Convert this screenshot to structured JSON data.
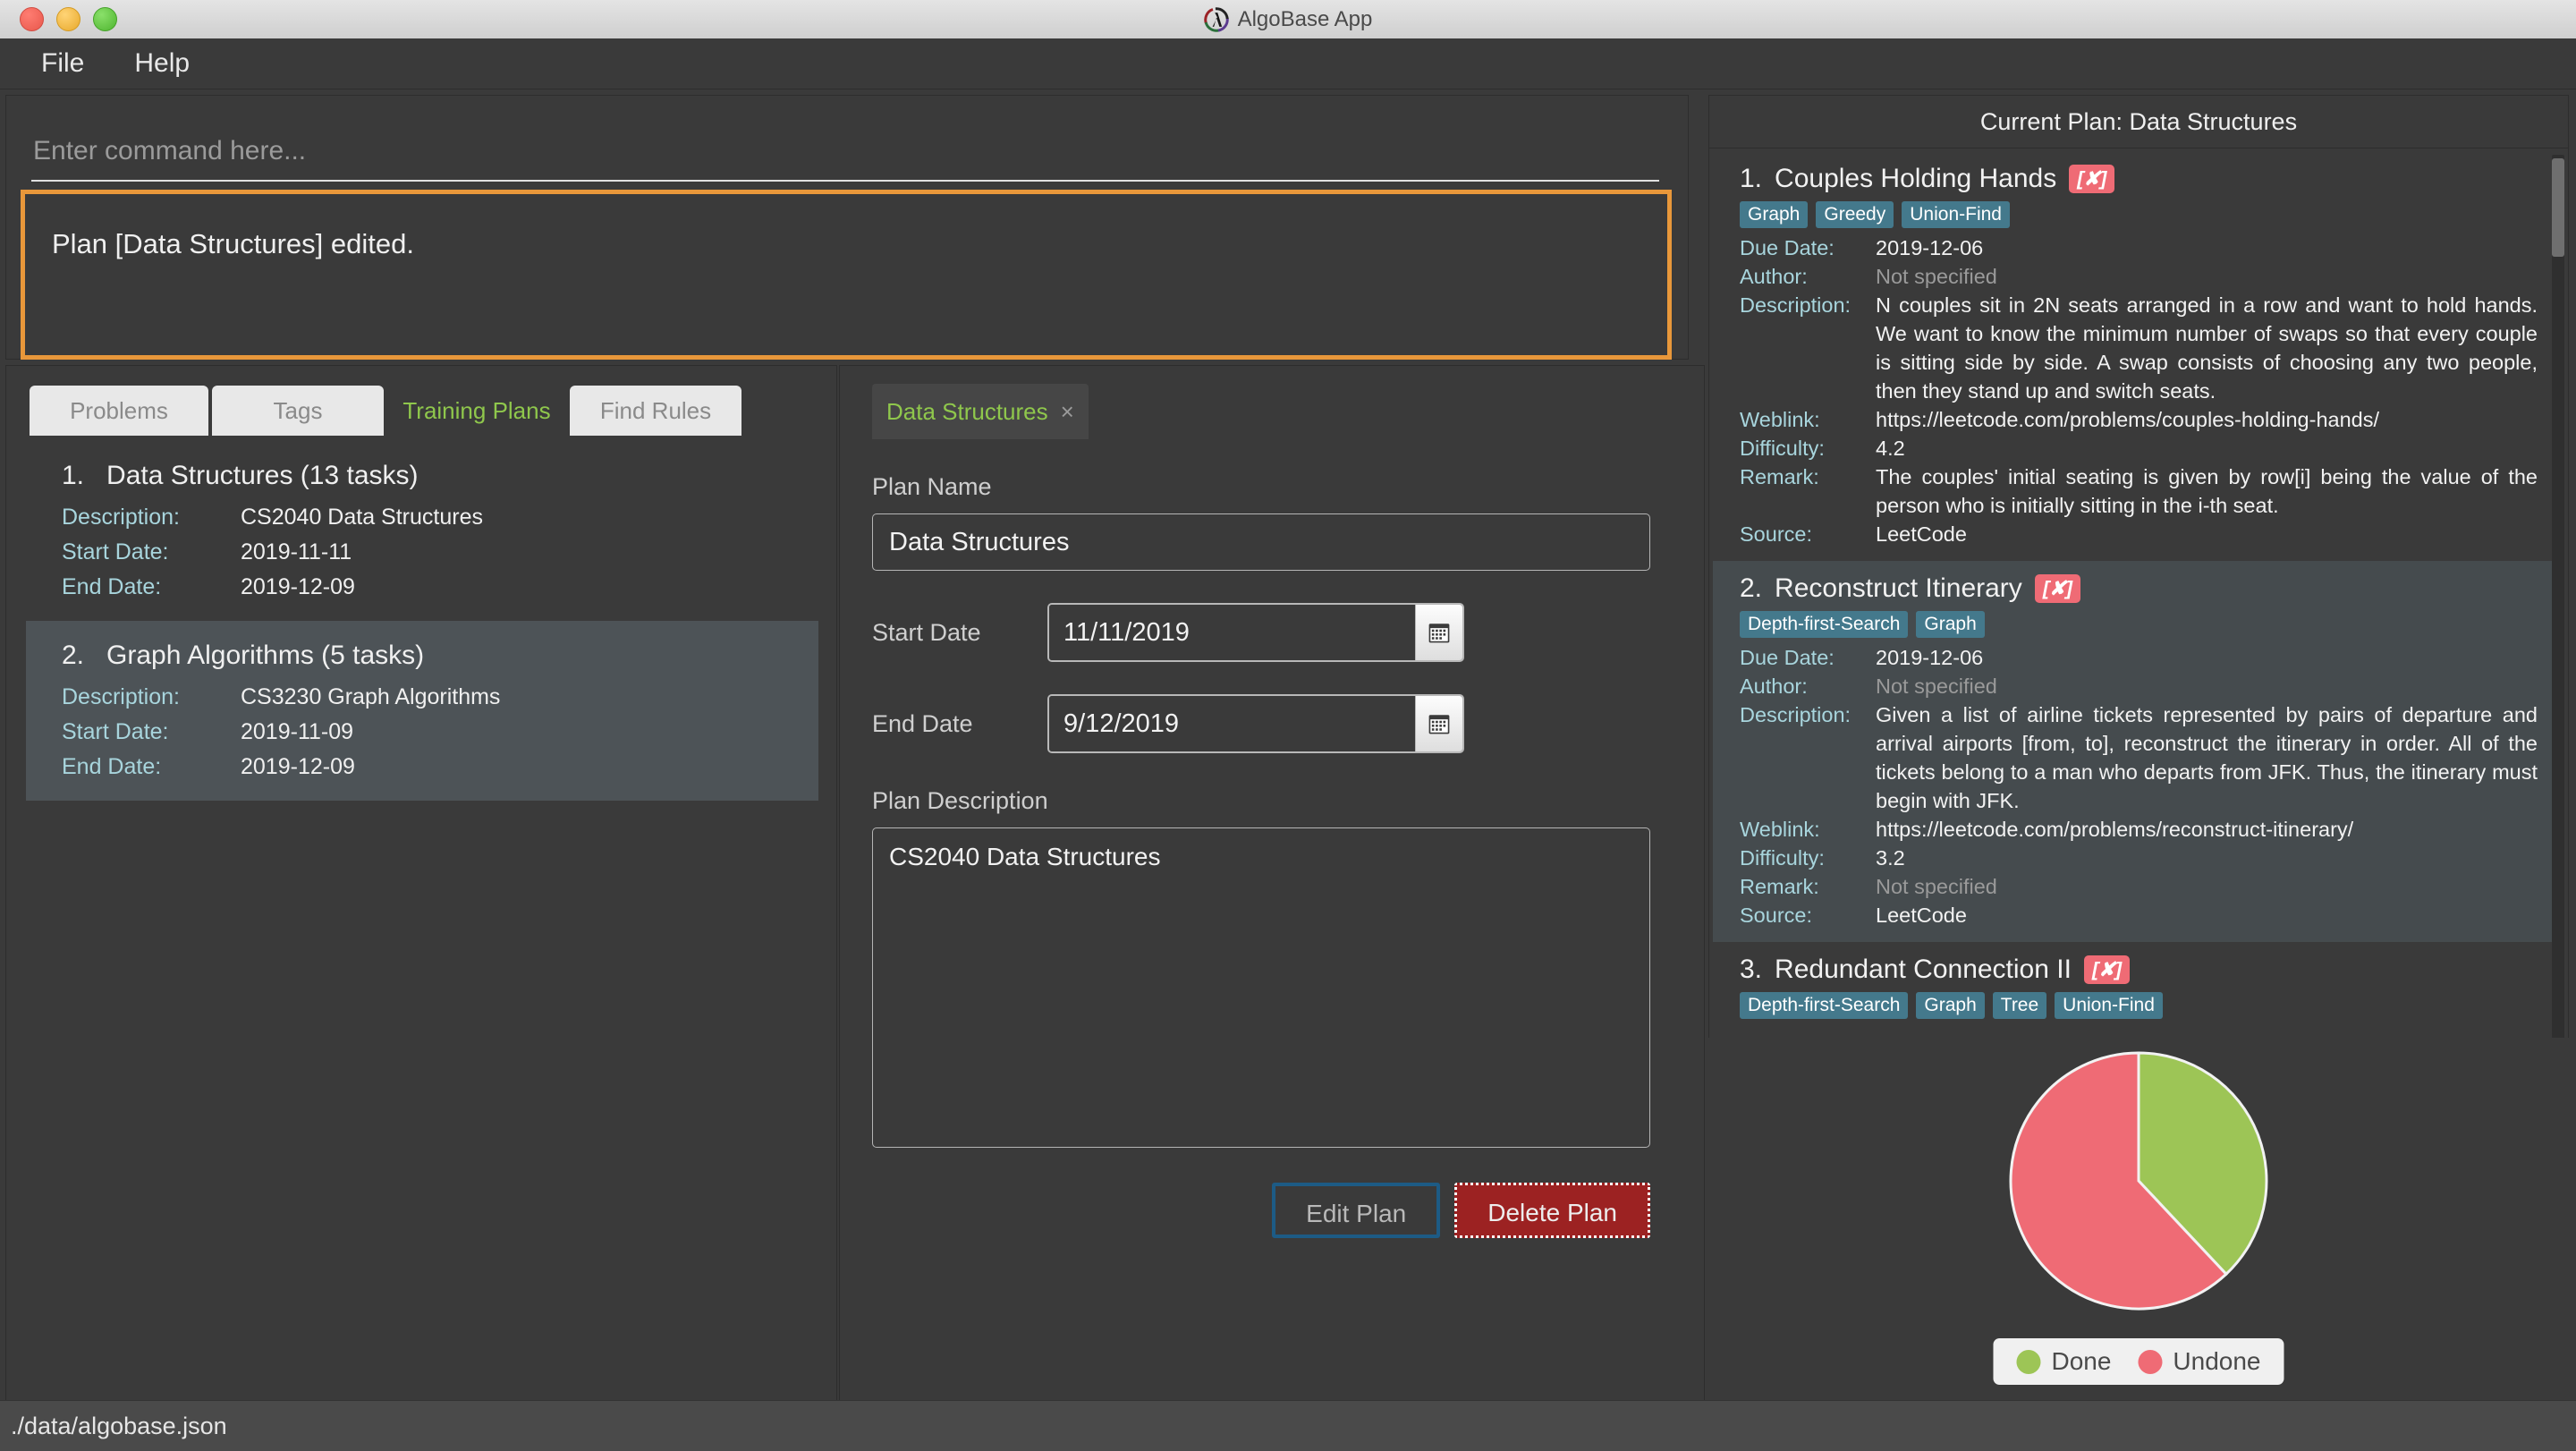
{
  "window": {
    "title": "AlgoBase App",
    "icon": "lambda-circle-icon"
  },
  "menubar": {
    "items": [
      {
        "label": "File"
      },
      {
        "label": "Help"
      }
    ]
  },
  "command": {
    "placeholder": "Enter command here...",
    "value": "",
    "result_message": "Plan [Data Structures] edited."
  },
  "left_panel": {
    "tabs": [
      {
        "label": "Problems",
        "active": false
      },
      {
        "label": "Tags",
        "active": false
      },
      {
        "label": "Training Plans",
        "active": true
      },
      {
        "label": "Find Rules",
        "active": false
      }
    ],
    "labels": {
      "description": "Description:",
      "start_date": "Start Date:",
      "end_date": "End Date:"
    },
    "plans": [
      {
        "index": "1.",
        "title": "Data Structures (13 tasks)",
        "description": "CS2040 Data Structures",
        "start_date": "2019-11-11",
        "end_date": "2019-12-09",
        "selected": false
      },
      {
        "index": "2.",
        "title": "Graph Algorithms (5 tasks)",
        "description": "CS3230 Graph Algorithms",
        "start_date": "2019-11-09",
        "end_date": "2019-12-09",
        "selected": true
      }
    ]
  },
  "center_panel": {
    "doc_tab": {
      "label": "Data Structures",
      "close_icon": "×"
    },
    "plan_name_label": "Plan Name",
    "plan_name_value": "Data Structures",
    "start_date_label": "Start Date",
    "start_date_value": "11/11/2019",
    "end_date_label": "End Date",
    "end_date_value": "9/12/2019",
    "plan_description_label": "Plan Description",
    "plan_description_value": "CS2040 Data Structures",
    "edit_button": "Edit Plan",
    "delete_button": "Delete Plan",
    "calendar_icon": "calendar-icon"
  },
  "right_panel": {
    "header": "Current Plan: Data Structures",
    "labels": {
      "due_date": "Due Date:",
      "author": "Author:",
      "description": "Description:",
      "weblink": "Weblink:",
      "difficulty": "Difficulty:",
      "remark": "Remark:",
      "source": "Source:"
    },
    "tasks": [
      {
        "index": "1.",
        "title": "Couples Holding Hands",
        "status_badge": "[✘]",
        "tags": [
          "Graph",
          "Greedy",
          "Union-Find"
        ],
        "due_date": "2019-12-06",
        "author": "Not specified",
        "description": "N couples sit in 2N seats arranged in a row and want to hold hands. We want to know the minimum number of swaps so that every couple is sitting side by side. A swap consists of choosing any two people, then they stand up and switch seats.",
        "weblink": "https://leetcode.com/problems/couples-holding-hands/",
        "difficulty": "4.2",
        "remark": "The couples' initial seating is given by row[i] being the value of the person who is initially sitting in the i-th seat.",
        "source": "LeetCode"
      },
      {
        "index": "2.",
        "title": "Reconstruct Itinerary",
        "status_badge": "[✘]",
        "tags": [
          "Depth-first-Search",
          "Graph"
        ],
        "due_date": "2019-12-06",
        "author": "Not specified",
        "description": "Given a list of airline tickets represented by pairs of departure and arrival airports [from, to], reconstruct the itinerary in order. All of the tickets belong to a man who departs from JFK. Thus, the itinerary must begin with JFK.",
        "weblink": "https://leetcode.com/problems/reconstruct-itinerary/",
        "difficulty": "3.2",
        "remark": "Not specified",
        "source": "LeetCode"
      },
      {
        "index": "3.",
        "title": "Redundant Connection II",
        "status_badge": "[✘]",
        "tags": [
          "Depth-first-Search",
          "Graph",
          "Tree",
          "Union-Find"
        ]
      }
    ]
  },
  "chart_data": {
    "type": "pie",
    "title": "",
    "categories": [
      "Done",
      "Undone"
    ],
    "values": [
      38,
      62
    ],
    "colors": [
      "#9dc556",
      "#ef6b75"
    ],
    "legend_position": "bottom",
    "start_angle_deg": 0,
    "direction": "clockwise"
  },
  "statusbar": {
    "file_path": "./data/algobase.json"
  },
  "colors": {
    "accent_green": "#8fc74c",
    "highlight_orange": "#e8973a",
    "tag_blue": "#44798c",
    "label_cyan": "#a8d5dd",
    "danger_red": "#9c2222",
    "badge_red": "#ef6b75",
    "panel_bg": "#3a3a3a",
    "selected_bg": "#4d5357"
  }
}
